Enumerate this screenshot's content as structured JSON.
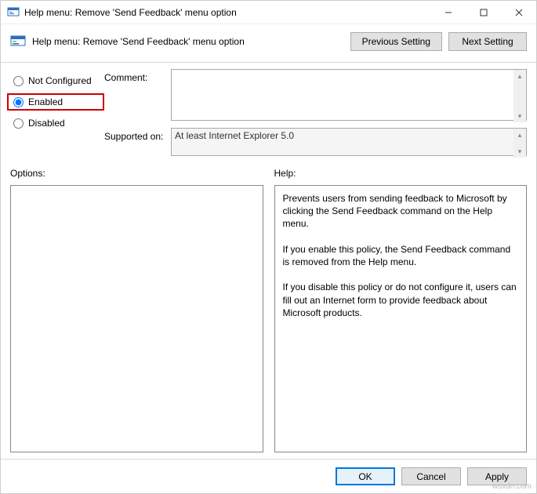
{
  "window": {
    "title": "Help menu: Remove 'Send Feedback' menu option",
    "header_label": "Help menu: Remove 'Send Feedback' menu option"
  },
  "nav": {
    "prev": "Previous Setting",
    "next": "Next Setting"
  },
  "radios": {
    "not_configured": "Not Configured",
    "enabled": "Enabled",
    "disabled": "Disabled",
    "selected": "enabled"
  },
  "fields": {
    "comment_label": "Comment:",
    "comment_value": "",
    "supported_label": "Supported on:",
    "supported_value": "At least Internet Explorer 5.0"
  },
  "panes": {
    "options_label": "Options:",
    "options_body": "",
    "help_label": "Help:",
    "help_body": "Prevents users from sending feedback to Microsoft by clicking the Send Feedback command on the Help menu.\n\nIf you enable this policy, the Send Feedback command is removed from the Help menu.\n\nIf you disable this policy or do not configure it, users can fill out an Internet form to provide feedback about Microsoft products."
  },
  "footer": {
    "ok": "OK",
    "cancel": "Cancel",
    "apply": "Apply"
  },
  "watermark": "wsxdn.com"
}
